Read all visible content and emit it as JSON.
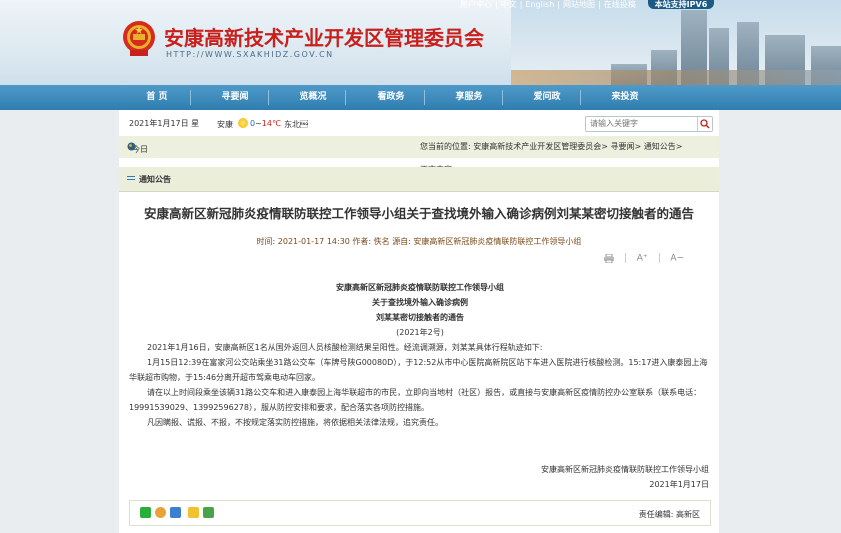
{
  "header": {
    "top_links": [
      "用户中心",
      "中文",
      "English",
      "网站地图",
      "在线投稿"
    ],
    "ipv6_label": "本站支持IPV6",
    "site_title": "安康高新技术产业开发区管理委员会",
    "site_url": "HTTP://WWW.SXAKHIDZ.GOV.CN"
  },
  "nav": {
    "items": [
      "首 页",
      "寻要闻",
      "览概况",
      "看政务",
      "享服务",
      "爱问政",
      "来投资"
    ]
  },
  "infobar": {
    "date": "2021年1月17日  星",
    "location": "安康",
    "temp_low": "0",
    "temp_sep": "~",
    "temp_high": "14℃",
    "wind": "东北\u0005",
    "search_placeholder": "请输入关键字"
  },
  "crumbbar": {
    "today_label": "今日",
    "location_text": "您当前的位置:   安康高新技术产业开发区管理委员会>  寻要闻>  通知公告>",
    "content_label": "正文内容"
  },
  "notice": {
    "label": "通知公告"
  },
  "article": {
    "title": "安康高新区新冠肺炎疫情联防联控工作领导小组关于查找境外输入确诊病例刘某某密切接触者的通告",
    "meta": "时间:  2021-01-17 14:30     作者:  佚名     源自:  安康高新区新冠肺炎疫情联防联控工作领导小组",
    "font_large": "A⁺",
    "font_small": "A−",
    "heading_lines": [
      "安康高新区新冠肺炎疫情联防联控工作领导小组",
      "关于查找境外输入确诊病例",
      "刘某某密切接触者的通告"
    ],
    "doc_no": "(2021年2号)",
    "paragraphs": [
      "2021年1月16日，安康高新区1名从国外返回人员核酸检测结果呈阳性。经流调溯源，刘某某具体行程轨迹如下:",
      "1月15日12:39在富家河公交站乘坐31路公交车（车牌号陕G00080D），于12:52从市中心医院高新院区站下车进入医院进行核酸检测。15:17进入康泰园上海华联超市购物，于15:46分离开超市驾乘电动车回家。",
      "请在以上时间段乘坐该辆31路公交车和进入康泰园上海华联超市的市民，立即向当地村（社区）报告，或直接与安康高新区疫情防控办公室联系（联系电话：19991539029、13992596278），服从防控安排和要求，配合落实各项防控措施。",
      "凡因瞒报、谎报、不报，不按规定落实防控措施，将依据相关法律法规，追究责任。"
    ],
    "signature": "安康高新区新冠肺炎疫情联防联控工作领导小组",
    "sign_date": "2021年1月17日",
    "editor": "责任编辑:   高新区"
  },
  "colors": {
    "nav": "#2f7db0",
    "title_red": "#c8201c",
    "notice_bg": "#eceedc"
  }
}
